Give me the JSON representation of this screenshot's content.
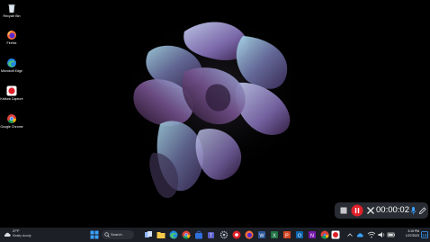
{
  "desktop": {
    "icons": [
      {
        "label": "Recycle Bin",
        "icon": "recycle-bin-icon"
      },
      {
        "label": "Firefox",
        "icon": "firefox-icon"
      },
      {
        "label": "Microsoft Edge",
        "icon": "edge-icon"
      },
      {
        "label": "Kaltura Capture",
        "icon": "kaltura-capture-icon"
      },
      {
        "label": "Google Chrome",
        "icon": "chrome-icon"
      }
    ]
  },
  "recorder": {
    "time": "00:00:02",
    "controls": [
      "stop-icon",
      "pause-icon",
      "close-icon",
      "mic-icon",
      "pen-icon"
    ]
  },
  "taskbar": {
    "weather": {
      "temp": "27°F",
      "condition": "Mostly cloudy"
    },
    "search_label": "Search",
    "clock": {
      "time": "3:15 PM",
      "date": "1/27/2023"
    },
    "apps": [
      "start-icon",
      "search-icon",
      "task-view-icon",
      "file-explorer-icon",
      "edge-icon",
      "chrome-icon",
      "store-icon",
      "teams-icon",
      "settings-icon",
      "photos-icon",
      "firefox-icon",
      "word-icon",
      "excel-icon",
      "powerpoint-icon",
      "outlook-icon",
      "onenote-icon",
      "chrome-icon",
      "kaltura-icon"
    ],
    "tray": [
      "chevron-up-icon",
      "cloud-icon",
      "wifi-icon",
      "volume-icon",
      "battery-icon"
    ],
    "colors": {
      "taskbar": "#1c1f26",
      "accent": "#e0202a"
    }
  }
}
